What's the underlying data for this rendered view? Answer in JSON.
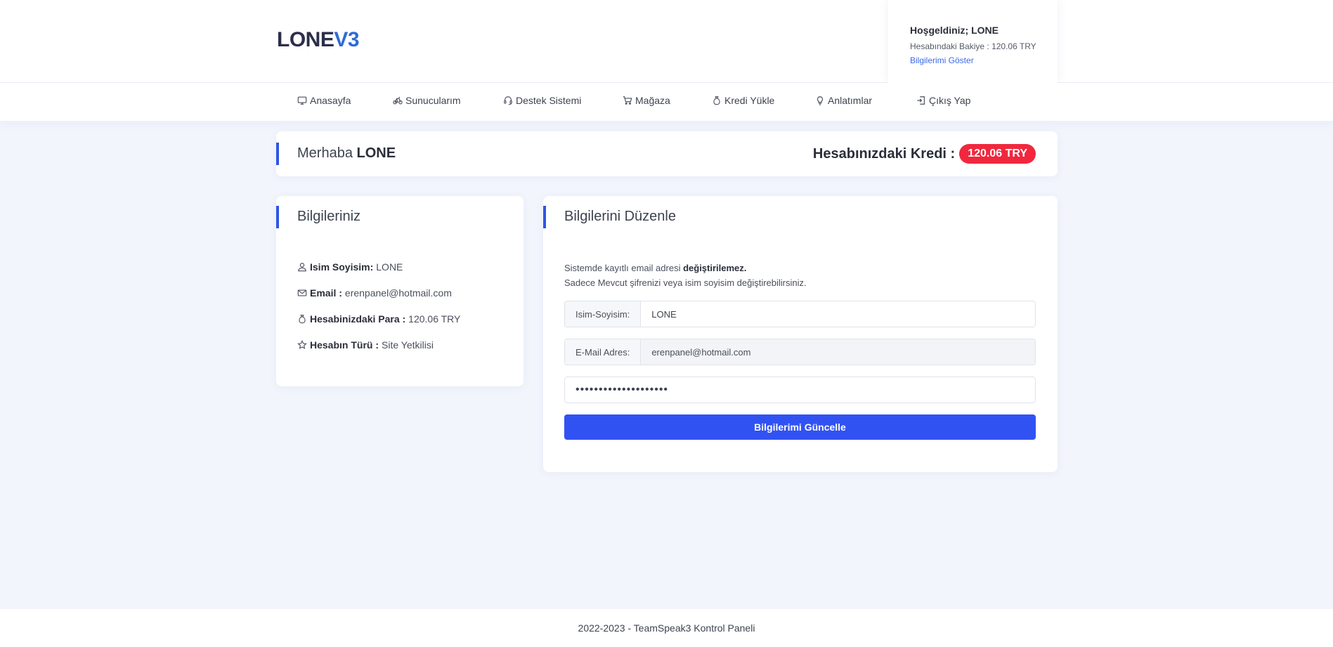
{
  "brand": {
    "name_main": "LONE",
    "name_accent": "V3"
  },
  "welcome": {
    "title": "Hoşgeldiniz; LONE",
    "balance": "Hesabındaki Bakiye : 120.06 TRY",
    "link": "Bilgilerimi Göster"
  },
  "nav": {
    "items": [
      {
        "label": "Anasayfa",
        "icon": "monitor-icon"
      },
      {
        "label": "Sunucularım",
        "icon": "bicycle-icon"
      },
      {
        "label": "Destek Sistemi",
        "icon": "headset-icon"
      },
      {
        "label": "Mağaza",
        "icon": "cart-icon"
      },
      {
        "label": "Kredi Yükle",
        "icon": "moneybag-icon"
      },
      {
        "label": "Anlatımlar",
        "icon": "lightbulb-icon"
      },
      {
        "label": "Çıkış Yap",
        "icon": "logout-icon"
      }
    ]
  },
  "greeting": {
    "prefix": "Merhaba",
    "name": "LONE",
    "credit_label": "Hesabınızdaki Kredi :",
    "credit_value": "120.06 TRY"
  },
  "info_card": {
    "title": "Bilgileriniz",
    "rows": [
      {
        "label": "Isim Soyisim:",
        "value": "LONE",
        "icon": "user-icon"
      },
      {
        "label": "Email :",
        "value": "erenpanel@hotmail.com",
        "icon": "envelope-icon"
      },
      {
        "label": "Hesabinizdaki Para :",
        "value": "120.06 TRY",
        "icon": "moneybag-icon"
      },
      {
        "label": "Hesabın Türü :",
        "value": "Site Yetkilisi",
        "icon": "star-icon"
      }
    ]
  },
  "edit_card": {
    "title": "Bilgilerini Düzenle",
    "notice_text": "Sistemde kayıtlı email adresi",
    "notice_bold": "değiştirilemez.",
    "notice_line2": "Sadece Mevcut şifrenizi veya isim soyisim değiştirebilirsiniz.",
    "name_label": "Isim-Soyisim:",
    "name_value": "LONE",
    "email_label": "E-Mail Adres:",
    "email_value": "erenpanel@hotmail.com",
    "password_value": "••••••••••••••••••••",
    "submit_label": "Bilgilerimi Güncelle"
  },
  "footer": {
    "text": "2022-2023 - TeamSpeak3 Kontrol Paneli"
  },
  "colors": {
    "accent": "#3152f3",
    "badge": "#f1283d",
    "logo_accent": "#2f6bd6",
    "background": "#f2f5fc"
  }
}
